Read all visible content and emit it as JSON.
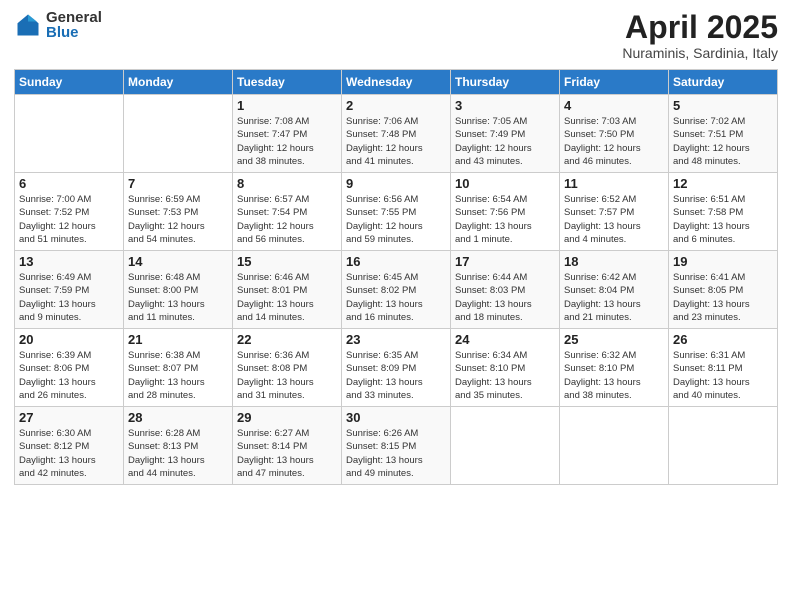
{
  "logo": {
    "general": "General",
    "blue": "Blue"
  },
  "title": "April 2025",
  "location": "Nuraminis, Sardinia, Italy",
  "days_header": [
    "Sunday",
    "Monday",
    "Tuesday",
    "Wednesday",
    "Thursday",
    "Friday",
    "Saturday"
  ],
  "weeks": [
    [
      {
        "day": "",
        "info": ""
      },
      {
        "day": "",
        "info": ""
      },
      {
        "day": "1",
        "info": "Sunrise: 7:08 AM\nSunset: 7:47 PM\nDaylight: 12 hours\nand 38 minutes."
      },
      {
        "day": "2",
        "info": "Sunrise: 7:06 AM\nSunset: 7:48 PM\nDaylight: 12 hours\nand 41 minutes."
      },
      {
        "day": "3",
        "info": "Sunrise: 7:05 AM\nSunset: 7:49 PM\nDaylight: 12 hours\nand 43 minutes."
      },
      {
        "day": "4",
        "info": "Sunrise: 7:03 AM\nSunset: 7:50 PM\nDaylight: 12 hours\nand 46 minutes."
      },
      {
        "day": "5",
        "info": "Sunrise: 7:02 AM\nSunset: 7:51 PM\nDaylight: 12 hours\nand 48 minutes."
      }
    ],
    [
      {
        "day": "6",
        "info": "Sunrise: 7:00 AM\nSunset: 7:52 PM\nDaylight: 12 hours\nand 51 minutes."
      },
      {
        "day": "7",
        "info": "Sunrise: 6:59 AM\nSunset: 7:53 PM\nDaylight: 12 hours\nand 54 minutes."
      },
      {
        "day": "8",
        "info": "Sunrise: 6:57 AM\nSunset: 7:54 PM\nDaylight: 12 hours\nand 56 minutes."
      },
      {
        "day": "9",
        "info": "Sunrise: 6:56 AM\nSunset: 7:55 PM\nDaylight: 12 hours\nand 59 minutes."
      },
      {
        "day": "10",
        "info": "Sunrise: 6:54 AM\nSunset: 7:56 PM\nDaylight: 13 hours\nand 1 minute."
      },
      {
        "day": "11",
        "info": "Sunrise: 6:52 AM\nSunset: 7:57 PM\nDaylight: 13 hours\nand 4 minutes."
      },
      {
        "day": "12",
        "info": "Sunrise: 6:51 AM\nSunset: 7:58 PM\nDaylight: 13 hours\nand 6 minutes."
      }
    ],
    [
      {
        "day": "13",
        "info": "Sunrise: 6:49 AM\nSunset: 7:59 PM\nDaylight: 13 hours\nand 9 minutes."
      },
      {
        "day": "14",
        "info": "Sunrise: 6:48 AM\nSunset: 8:00 PM\nDaylight: 13 hours\nand 11 minutes."
      },
      {
        "day": "15",
        "info": "Sunrise: 6:46 AM\nSunset: 8:01 PM\nDaylight: 13 hours\nand 14 minutes."
      },
      {
        "day": "16",
        "info": "Sunrise: 6:45 AM\nSunset: 8:02 PM\nDaylight: 13 hours\nand 16 minutes."
      },
      {
        "day": "17",
        "info": "Sunrise: 6:44 AM\nSunset: 8:03 PM\nDaylight: 13 hours\nand 18 minutes."
      },
      {
        "day": "18",
        "info": "Sunrise: 6:42 AM\nSunset: 8:04 PM\nDaylight: 13 hours\nand 21 minutes."
      },
      {
        "day": "19",
        "info": "Sunrise: 6:41 AM\nSunset: 8:05 PM\nDaylight: 13 hours\nand 23 minutes."
      }
    ],
    [
      {
        "day": "20",
        "info": "Sunrise: 6:39 AM\nSunset: 8:06 PM\nDaylight: 13 hours\nand 26 minutes."
      },
      {
        "day": "21",
        "info": "Sunrise: 6:38 AM\nSunset: 8:07 PM\nDaylight: 13 hours\nand 28 minutes."
      },
      {
        "day": "22",
        "info": "Sunrise: 6:36 AM\nSunset: 8:08 PM\nDaylight: 13 hours\nand 31 minutes."
      },
      {
        "day": "23",
        "info": "Sunrise: 6:35 AM\nSunset: 8:09 PM\nDaylight: 13 hours\nand 33 minutes."
      },
      {
        "day": "24",
        "info": "Sunrise: 6:34 AM\nSunset: 8:10 PM\nDaylight: 13 hours\nand 35 minutes."
      },
      {
        "day": "25",
        "info": "Sunrise: 6:32 AM\nSunset: 8:10 PM\nDaylight: 13 hours\nand 38 minutes."
      },
      {
        "day": "26",
        "info": "Sunrise: 6:31 AM\nSunset: 8:11 PM\nDaylight: 13 hours\nand 40 minutes."
      }
    ],
    [
      {
        "day": "27",
        "info": "Sunrise: 6:30 AM\nSunset: 8:12 PM\nDaylight: 13 hours\nand 42 minutes."
      },
      {
        "day": "28",
        "info": "Sunrise: 6:28 AM\nSunset: 8:13 PM\nDaylight: 13 hours\nand 44 minutes."
      },
      {
        "day": "29",
        "info": "Sunrise: 6:27 AM\nSunset: 8:14 PM\nDaylight: 13 hours\nand 47 minutes."
      },
      {
        "day": "30",
        "info": "Sunrise: 6:26 AM\nSunset: 8:15 PM\nDaylight: 13 hours\nand 49 minutes."
      },
      {
        "day": "",
        "info": ""
      },
      {
        "day": "",
        "info": ""
      },
      {
        "day": "",
        "info": ""
      }
    ]
  ]
}
